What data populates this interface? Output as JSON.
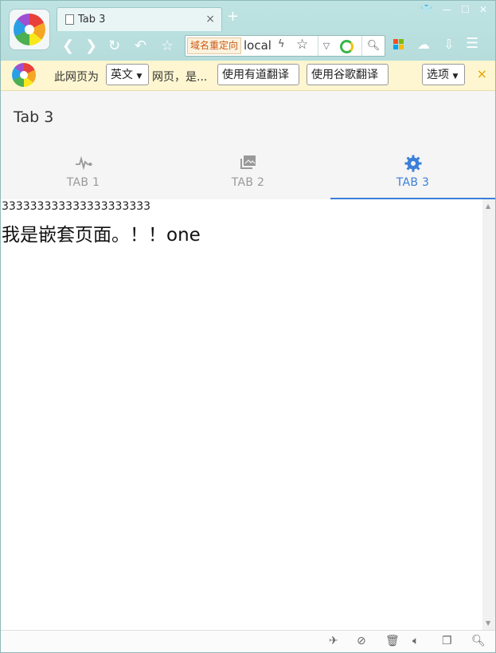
{
  "browser": {
    "tab_title": "Tab 3",
    "tab_close": "×",
    "new_tab": "+",
    "address": {
      "redirect_label": "域名重定向",
      "url": "local"
    },
    "window_controls": [
      "shirt-icon",
      "minimize-icon",
      "maximize-icon",
      "close-icon"
    ]
  },
  "translate_bar": {
    "prefix": "此网页为",
    "language": "英文",
    "middle": "网页，是...",
    "youdao_button": "使用有道翻译",
    "google_button": "使用谷歌翻译",
    "options_button": "选项",
    "close": "×"
  },
  "app": {
    "title": "Tab 3",
    "tabs": [
      {
        "label": "TAB 1",
        "icon": "pulse-icon",
        "active": false
      },
      {
        "label": "TAB 2",
        "icon": "album-icon",
        "active": false
      },
      {
        "label": "TAB 3",
        "icon": "gear-icon",
        "active": true
      }
    ]
  },
  "content": {
    "line1": "333333333333333333333",
    "line2": "我是嵌套页面。！！one"
  },
  "colors": {
    "active_tab": "#3b7fd9",
    "inactive_tab": "#999999",
    "titlebar": "#bfe3e3",
    "translate_bar": "#fdf6d0"
  }
}
